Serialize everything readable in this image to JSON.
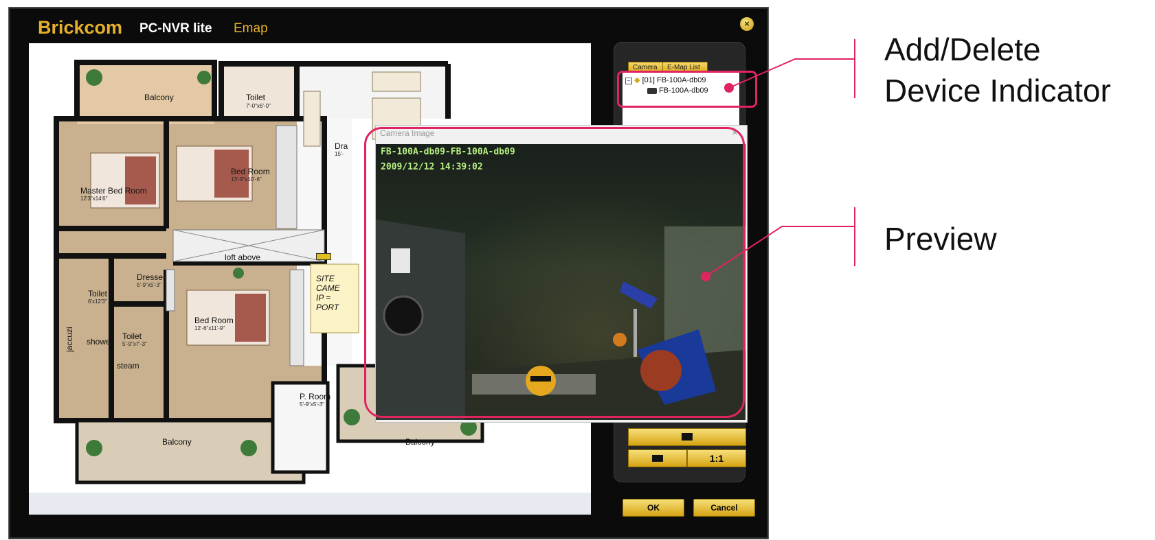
{
  "app": {
    "brand": "Brickcom",
    "product": "PC-NVR lite",
    "module": "Emap"
  },
  "floorplan": {
    "rooms": [
      {
        "label": "Balcony"
      },
      {
        "label": "Toilet",
        "dim": "7'-0\"x6'-0\""
      },
      {
        "label": "Master Bed Room",
        "dim": "12'3\"x14'6\""
      },
      {
        "label": "Bed Room",
        "dim": "13'-9\"x10'-6\""
      },
      {
        "label": "Dra",
        "dim": "15'-"
      },
      {
        "label": "Dresser",
        "dim": "5'-9\"x5'-3\""
      },
      {
        "label": "Toilet",
        "dim": "6'x12'3\""
      },
      {
        "label": "Bed Room",
        "dim": "12'-6\"x11'-9\""
      },
      {
        "label": "Toilet",
        "dim": "5'-9\"x7'-3\""
      },
      {
        "label": "shower"
      },
      {
        "label": "jaccuzi"
      },
      {
        "label": "steam"
      },
      {
        "label": "Balcony"
      },
      {
        "label": "P. Room",
        "dim": "5'-9\"x5'-3\""
      },
      {
        "label": "Balcony"
      }
    ],
    "loft_label": "loft above",
    "site_lines": [
      "SITE",
      "CAME",
      "IP =",
      "PORT"
    ]
  },
  "right_panel": {
    "tabs": [
      "Camera",
      "E-Map List"
    ],
    "tree": {
      "group": "[01] FB-100A-db09",
      "camera": "FB-100A-db09"
    },
    "buttons": {
      "snapshot_icon": "folder-camera-icon",
      "fit_icon": "window-fit-icon",
      "ratio_label": "1:1"
    }
  },
  "dialog": {
    "ok_label": "OK",
    "cancel_label": "Cancel"
  },
  "camera_image": {
    "title": "Camera Image",
    "close_label": "×",
    "osd_name": "FB-100A-db09-FB-100A-db09",
    "osd_timestamp": "2009/12/12   14:39:02"
  },
  "callouts": {
    "device_indicator": [
      "Add/Delete",
      "Device Indicator"
    ],
    "preview": "Preview",
    "accent_color": "#e0245f"
  }
}
